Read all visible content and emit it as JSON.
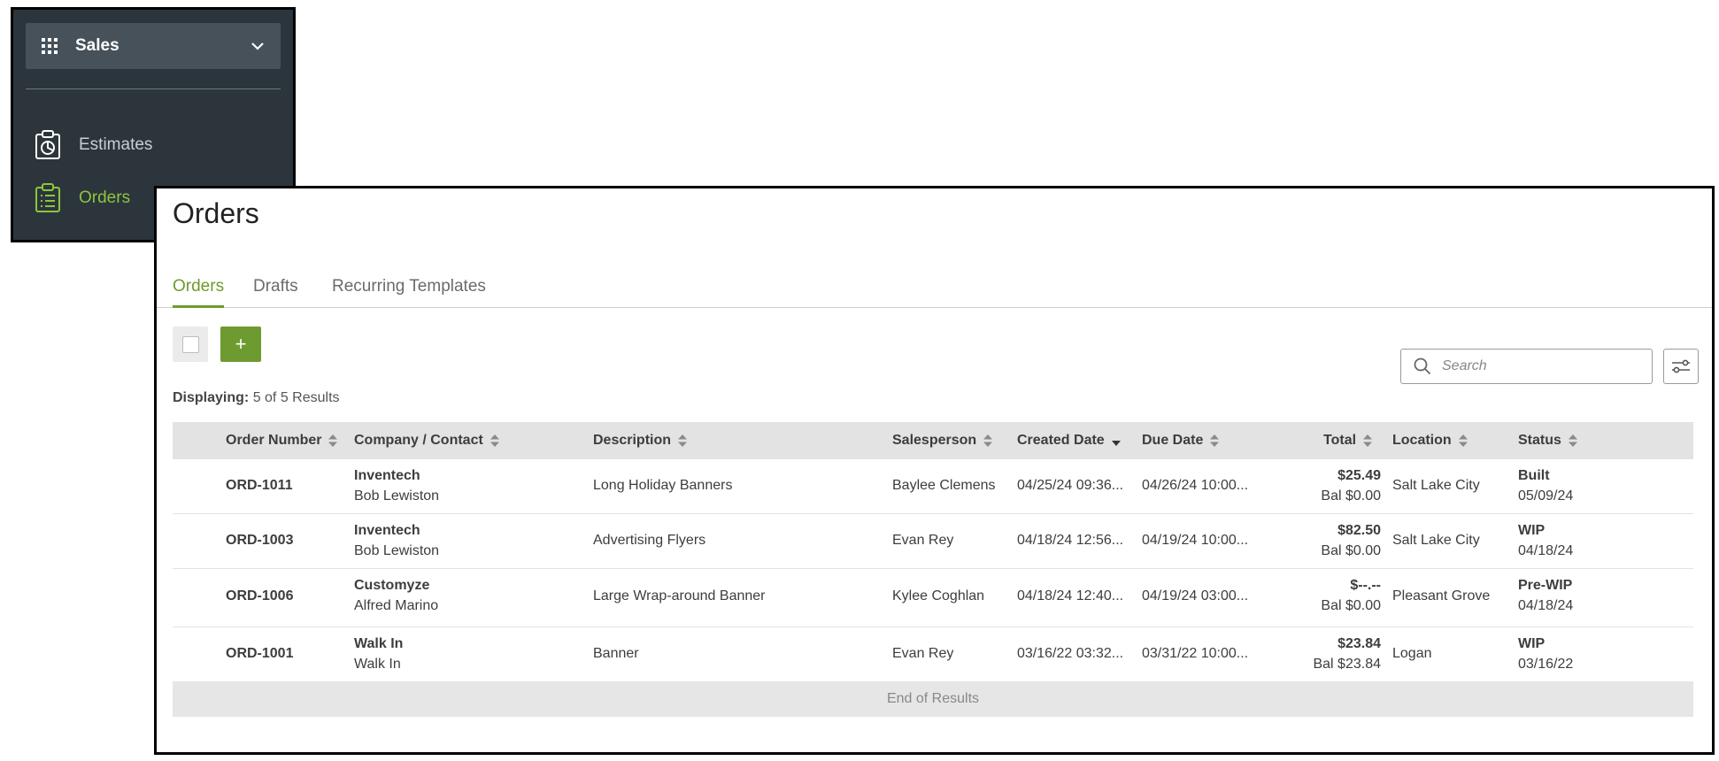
{
  "sidebar": {
    "section_label": "Sales",
    "items": [
      {
        "label": "Estimates",
        "icon": "clipboard-chart-icon",
        "active": false
      },
      {
        "label": "Orders",
        "icon": "clipboard-list-icon",
        "active": true
      }
    ]
  },
  "page": {
    "title": "Orders",
    "tabs": [
      {
        "label": "Orders",
        "active": true
      },
      {
        "label": "Drafts",
        "active": false
      },
      {
        "label": "Recurring Templates",
        "active": false
      }
    ],
    "add_label": "+",
    "displaying_prefix": "Displaying:",
    "displaying_value": "5 of 5 Results",
    "search_placeholder": "Search"
  },
  "table": {
    "columns": {
      "order_number": "Order Number",
      "company": "Company / Contact",
      "description": "Description",
      "salesperson": "Salesperson",
      "created": "Created Date",
      "due": "Due Date",
      "total": "Total",
      "location": "Location",
      "status": "Status"
    },
    "rows": [
      {
        "order": "ORD-1011",
        "company": "Inventech",
        "contact": "Bob Lewiston",
        "description": "Long Holiday Banners",
        "salesperson": "Baylee Clemens",
        "created": "04/25/24 09:36...",
        "due": "04/26/24 10:00...",
        "total": "$25.49",
        "balance": "Bal $0.00",
        "location": "Salt Lake City",
        "status": "Built",
        "status_date": "05/09/24"
      },
      {
        "order": "ORD-1003",
        "company": "Inventech",
        "contact": "Bob Lewiston",
        "description": "Advertising Flyers",
        "salesperson": "Evan Rey",
        "created": "04/18/24 12:56...",
        "due": "04/19/24 10:00...",
        "total": "$82.50",
        "balance": "Bal $0.00",
        "location": "Salt Lake City",
        "status": "WIP",
        "status_date": "04/18/24"
      },
      {
        "order": "ORD-1006",
        "company": "Customyze",
        "contact": "Alfred Marino",
        "description": "Large Wrap-around Banner",
        "salesperson": "Kylee Coghlan",
        "created": "04/18/24 12:40...",
        "due": "04/19/24 03:00...",
        "total": "$--.--",
        "balance": "Bal $0.00",
        "location": "Pleasant Grove",
        "status": "Pre-WIP",
        "status_date": "04/18/24"
      },
      {
        "order": "ORD-1001",
        "company": "Walk In",
        "contact": "Walk In",
        "description": "Banner",
        "salesperson": "Evan Rey",
        "created": "03/16/22 03:32...",
        "due": "03/31/22 10:00...",
        "total": "$23.84",
        "balance": "Bal $23.84",
        "location": "Logan",
        "status": "WIP",
        "status_date": "03/16/22"
      }
    ],
    "end_label": "End of Results"
  },
  "colors": {
    "sidebar_bg": "#2c353c",
    "accent": "#6e9b2f",
    "active_nav": "#8cc63f"
  }
}
